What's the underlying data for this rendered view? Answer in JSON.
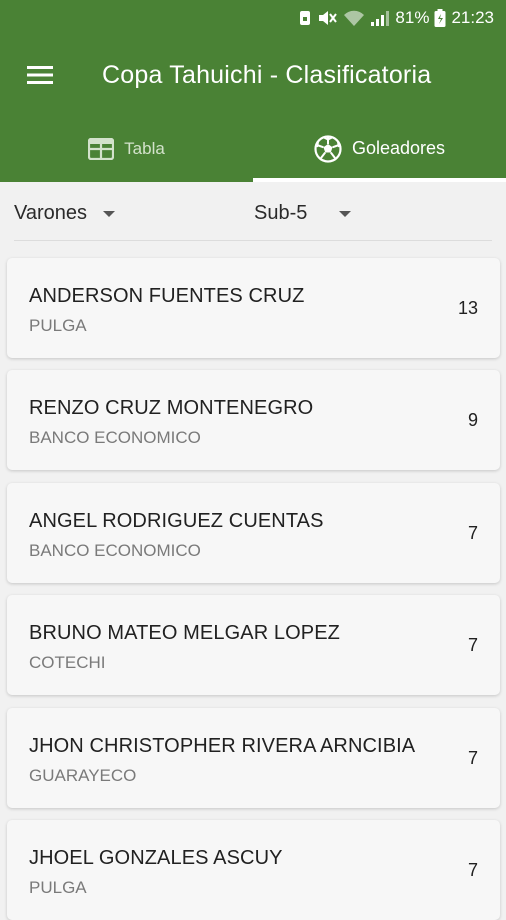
{
  "status": {
    "battery": "81%",
    "time": "21:23"
  },
  "header": {
    "title": "Copa Tahuichi - Clasificatoria"
  },
  "tabs": [
    {
      "label": "Tabla",
      "icon": "table-icon",
      "active": false
    },
    {
      "label": "Goleadores",
      "icon": "soccer-ball-icon",
      "active": true
    }
  ],
  "filters": {
    "gender": "Varones",
    "category": "Sub-5"
  },
  "scorers": [
    {
      "name": "ANDERSON FUENTES CRUZ",
      "team": "PULGA",
      "goals": "13"
    },
    {
      "name": "RENZO CRUZ MONTENEGRO",
      "team": "BANCO ECONOMICO",
      "goals": "9"
    },
    {
      "name": "ANGEL RODRIGUEZ CUENTAS",
      "team": "BANCO ECONOMICO",
      "goals": "7"
    },
    {
      "name": "BRUNO MATEO MELGAR LOPEZ",
      "team": "COTECHI",
      "goals": "7"
    },
    {
      "name": "JHON CHRISTOPHER RIVERA ARNCIBIA",
      "team": "GUARAYECO",
      "goals": "7"
    },
    {
      "name": "JHOEL GONZALES ASCUY",
      "team": "PULGA",
      "goals": "7"
    }
  ],
  "colors": {
    "primary": "#4a8235",
    "background": "#f1f1f1",
    "card": "#f7f7f7"
  }
}
